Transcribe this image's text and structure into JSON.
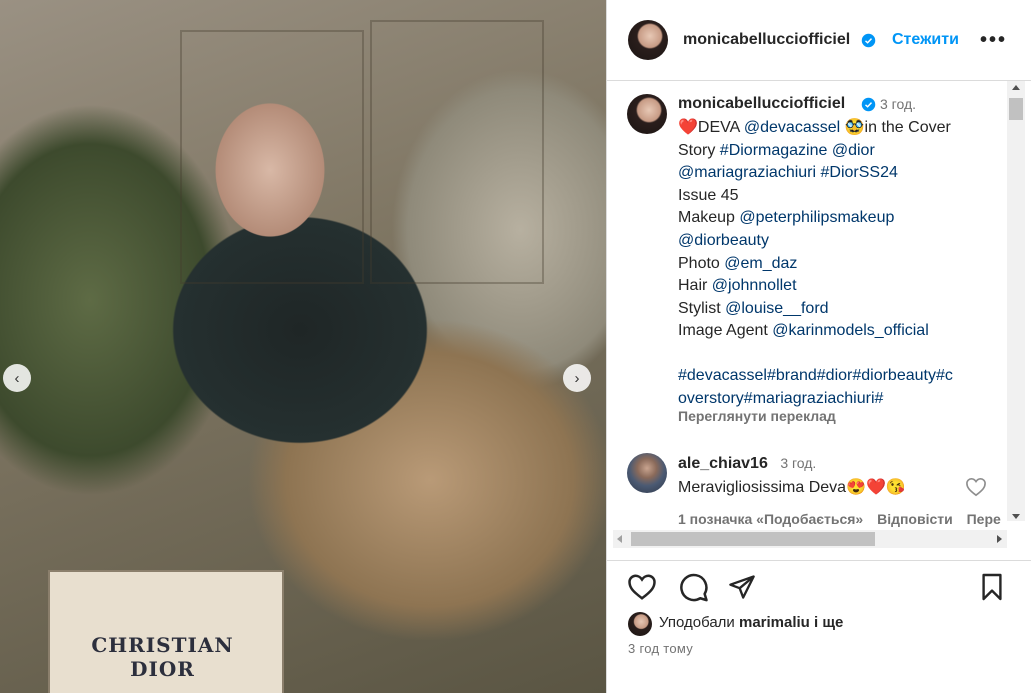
{
  "post": {
    "photo_text": "CHRISTIAN DIOR",
    "author": "monicabellucciofficiel",
    "follow_label": "Стежити",
    "more_label": "•••"
  },
  "caption": {
    "author": "monicabellucciofficiel",
    "time": "3 год.",
    "heart": "❤️",
    "t_deva": "DEVA ",
    "m_devacassel": "@devacassel",
    "emoji2": "🥸",
    "t_inthe": "in the Cover Story ",
    "h_diormagazine": "#Diormagazine",
    "m_dior": "@dior",
    "m_mariagrazia": "@mariagraziachiuri",
    "h_diorss24": "#DiorSS24",
    "issue": "Issue 45",
    "t_makeup": "Makeup ",
    "m_peterphilips": "@peterphilipsmakeup",
    "m_diorbeauty": "@diorbeauty",
    "t_photo": "Photo ",
    "m_emdaz": "@em_daz",
    "t_hair": "Hair ",
    "m_johnnollet": "@johnnollet",
    "t_stylist": "Stylist ",
    "m_louise": "@louise__ford",
    "t_agent": "Image Agent ",
    "m_karin": "@karinmodels_official",
    "hashtags_line1": "#devacassel#brand#dior#diorbeauty#c",
    "hashtags_line2": "overstory#mariagraziachiuri#",
    "translate_label": "Переглянути переклад"
  },
  "comment": {
    "author": "ale_chiav16",
    "time": "3 год.",
    "text": "Meravigliosissima Deva",
    "emojis": "😍❤️😘",
    "likes": "1 позначка «Подобається»",
    "reply": "Відповісти",
    "see_more": "Пере"
  },
  "footer": {
    "liked_by_prefix": "Уподобали",
    "liked_by_user": "marimaliu",
    "liked_by_suffix": "і ще",
    "time_ago": "3 год тому"
  },
  "colors": {
    "accent": "#0095f6",
    "verified": "#0095f6",
    "link": "#00376b",
    "muted": "#737373"
  }
}
